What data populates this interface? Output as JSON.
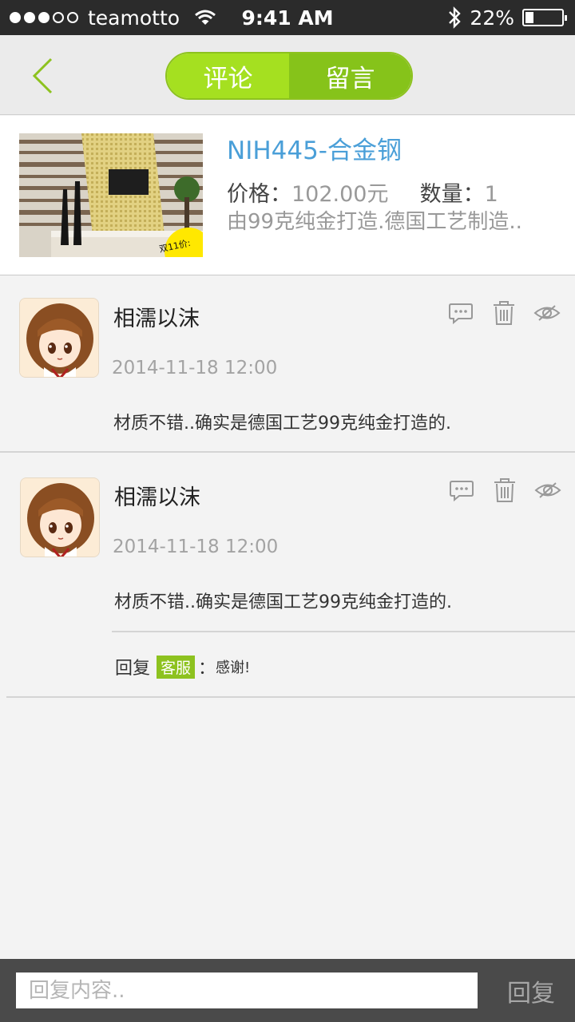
{
  "status_bar": {
    "carrier": "teamotto",
    "time": "9:41 AM",
    "battery_percent_label": "22%",
    "battery_level": 0.22,
    "signal_bars_filled": 3,
    "signal_bars_total": 5
  },
  "nav": {
    "back_icon": "chevron-left-icon",
    "tabs": [
      {
        "label": "评论",
        "active": false
      },
      {
        "label": "留言",
        "active": true
      }
    ]
  },
  "product": {
    "title": "NIH445-合金钢",
    "price_label": "价格：",
    "price_value": "102.00元",
    "quantity_label": "数量：",
    "quantity_value": "1",
    "description": "由99克纯金打造.德国工艺制造.."
  },
  "comments": [
    {
      "name": "相濡以沫",
      "date": "2014-11-18  12:00",
      "text": "材质不错..确实是德国工艺99克纯金打造的.",
      "icons": [
        "chat-bubble-icon",
        "trash-icon",
        "eye-icon"
      ]
    },
    {
      "name": "相濡以沫",
      "date": "2014-11-18  12:00",
      "text": "材质不错..确实是德国工艺99克纯金打造的.",
      "icons": [
        "chat-bubble-icon",
        "trash-icon",
        "eye-icon"
      ],
      "reply": {
        "prefix": "回复",
        "badge": "客服",
        "separator": "：",
        "text": "感谢!"
      }
    }
  ],
  "bottom_bar": {
    "input_placeholder": "回复内容..",
    "submit_label": "回复"
  },
  "colors": {
    "accent_green": "#8dc21f",
    "title_blue": "#4a9fd8",
    "status_bar_bg": "#2b2b2b",
    "bottom_bar_bg": "#4a4a4a"
  }
}
